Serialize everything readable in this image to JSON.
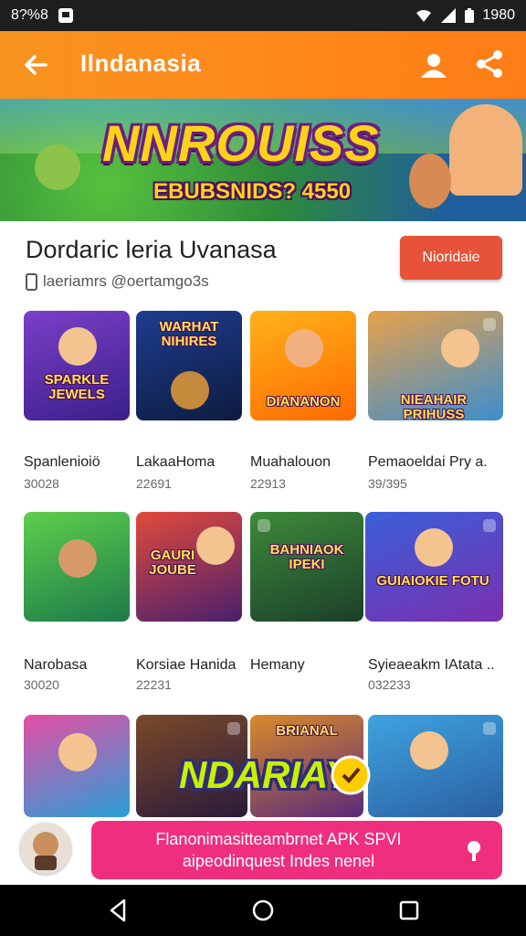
{
  "status": {
    "left_text": "8?%8",
    "time": "1980"
  },
  "appbar": {
    "title": "Ilndanasia"
  },
  "banner": {
    "title": "NNROUISS",
    "subtitle": "EBUBSNIDS? 4550"
  },
  "header": {
    "title": "Dordaric leria Uvanasa",
    "install_label": "Nioridaie",
    "meta_text": "laeriamrs @oertamgo3s"
  },
  "games": [
    {
      "name": "Spanlenioiö",
      "count": "30028",
      "art_text": "SPARKLE JEWELS"
    },
    {
      "name": "LakaaHoma",
      "count": "22691",
      "art_text": "WARHAT NIHIRES"
    },
    {
      "name": "Muahalouon",
      "count": "22913",
      "art_text": "DIANANON"
    },
    {
      "name": "Pemaoeldai Pry a.",
      "count": "39/395",
      "art_text": "NIEAHAIR PRIHUSS"
    },
    {
      "name": "Narobasa",
      "count": "30020",
      "art_text": ""
    },
    {
      "name": "Korsiae Hanida",
      "count": "22231",
      "art_text": "GAURI JOUBE"
    },
    {
      "name": "Hemany",
      "count": "",
      "art_text": "BAHNIAOK IPEKI"
    },
    {
      "name": "Syieaeakm IAtata ..",
      "count": "032233",
      "art_text": "GUIAIOKIE FOTU"
    },
    {
      "name": "",
      "count": "",
      "art_text": ""
    },
    {
      "name": "",
      "count": "",
      "art_text": "NDARIAY"
    },
    {
      "name": "",
      "count": "",
      "art_text": "BRIANAL"
    },
    {
      "name": "",
      "count": "",
      "art_text": ""
    }
  ],
  "promo": {
    "line1": "Flanonimasitteambrnet APK SPVI",
    "line2": "aipeodinquest Indes nenel"
  },
  "colors": {
    "appbar": "#f7931e",
    "install": "#e6533a",
    "promo": "#ef2f7d"
  }
}
